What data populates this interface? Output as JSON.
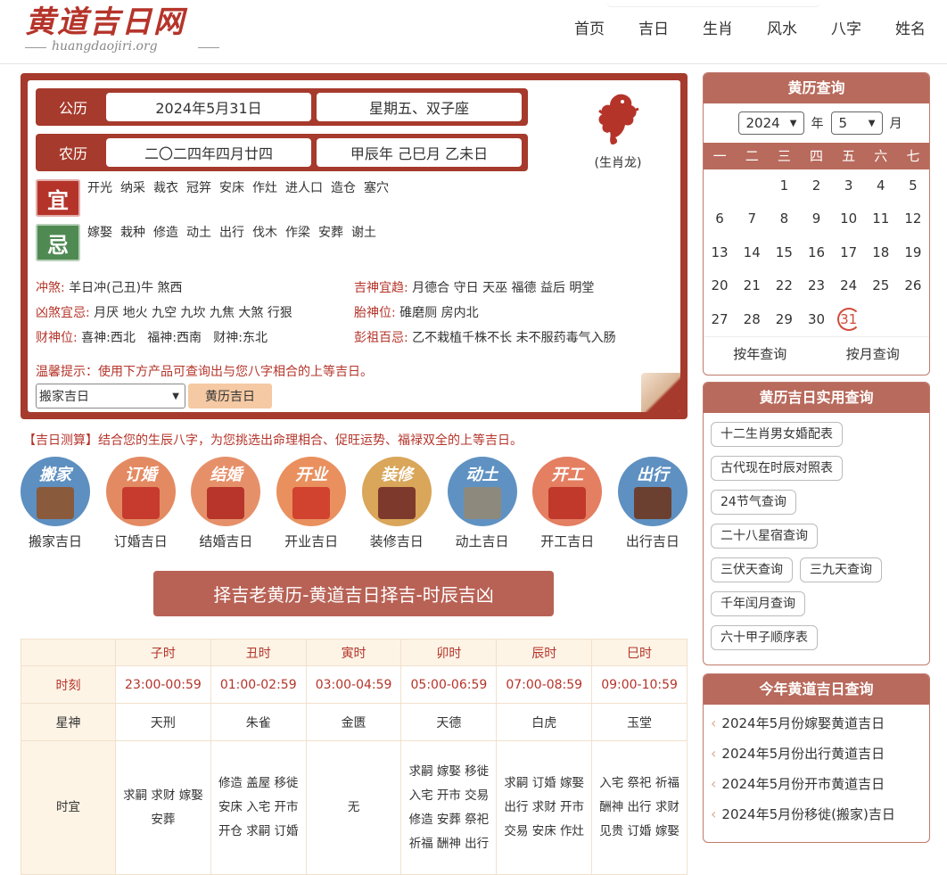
{
  "header": {
    "logo_title": "黄道吉日网",
    "logo_sub": "huangdaojiri.org",
    "nav": [
      "首页",
      "吉日",
      "生肖",
      "风水",
      "八字",
      "姓名"
    ]
  },
  "almanac": {
    "solar_label": "公历",
    "solar_date": "2024年5月31日",
    "weekday": "星期五、双子座",
    "lunar_label": "农历",
    "lunar_date": "二〇二四年四月廿四",
    "ganzhi": "甲辰年 己巳月 乙未日",
    "zodiac": "(生肖龙)",
    "yi_badge": "宜",
    "yi_items": [
      "开光",
      "纳采",
      "裁衣",
      "冠笄",
      "安床",
      "作灶",
      "进人口",
      "造仓",
      "塞穴"
    ],
    "ji_badge": "忌",
    "ji_items": [
      "嫁娶",
      "栽种",
      "修造",
      "动土",
      "出行",
      "伐木",
      "作梁",
      "安葬",
      "谢土"
    ],
    "chongsha_k": "冲煞:",
    "chongsha_v": "羊日冲(己丑)牛 煞西",
    "jishen_k": "吉神宜趋:",
    "jishen_v": "月德合 守日 天巫 福德 益后 明堂",
    "xiongsha_k": "凶煞宜忌:",
    "xiongsha_v": "月厌 地火 九空 九坎 九焦 大煞 行狠",
    "taishen_k": "胎神位:",
    "taishen_v": "碓磨厕 房内北",
    "caishen_k": "财神位:",
    "caishen_v": "喜神:西北   福神:西南   财神:东北",
    "pengzu_k": "彭祖百忌:",
    "pengzu_v": "乙不栽植千株不长 未不服药毒气入肠",
    "tip": "温馨提示：使用下方产品可查询出与您八字相合的上等吉日。",
    "select_value": "搬家吉日",
    "select_button": "黄历吉日"
  },
  "promo": {
    "text": "【吉日测算】结合您的生辰八字，为您挑选出命理相合、促旺运势、福禄双全的上等吉日。",
    "items": [
      {
        "title": "搬家",
        "label": "搬家吉日",
        "color": "#5d8fc0",
        "pic": "#8a5a3c"
      },
      {
        "title": "订婚",
        "label": "订婚吉日",
        "color": "#e48a62",
        "pic": "#c63b2e"
      },
      {
        "title": "结婚",
        "label": "结婚吉日",
        "color": "#e6906a",
        "pic": "#b7352a"
      },
      {
        "title": "开业",
        "label": "开业吉日",
        "color": "#e9905e",
        "pic": "#d1422f"
      },
      {
        "title": "装修",
        "label": "装修吉日",
        "color": "#d9a65a",
        "pic": "#7d3a2c"
      },
      {
        "title": "动土",
        "label": "动土吉日",
        "color": "#5f92c2",
        "pic": "#8d8a7d"
      },
      {
        "title": "开工",
        "label": "开工吉日",
        "color": "#e47f62",
        "pic": "#c0392b"
      },
      {
        "title": "出行",
        "label": "出行吉日",
        "color": "#5e90c1",
        "pic": "#6b4030"
      }
    ]
  },
  "banner": "择吉老黄历-黄道吉日择吉-时辰吉凶",
  "hours": {
    "names": [
      "子时",
      "丑时",
      "寅时",
      "卯时",
      "辰时",
      "巳时"
    ],
    "row_time_label": "时刻",
    "times": [
      "23:00-00:59",
      "01:00-02:59",
      "03:00-04:59",
      "05:00-06:59",
      "07:00-08:59",
      "09:00-10:59"
    ],
    "row_star_label": "星神",
    "stars": [
      "天刑",
      "朱雀",
      "金匮",
      "天德",
      "白虎",
      "玉堂"
    ],
    "row_yi_label": "时宜",
    "yi": [
      "求嗣 求财 嫁娶 安葬",
      "修造 盖屋 移徙 安床 入宅 开市 开仓 求嗣 订婚",
      "无",
      "求嗣 嫁娶 移徙 入宅 开市 交易 修造 安葬 祭祀 祈福 酬神 出行",
      "求嗣 订婚 嫁娶 出行 求财 开市 交易 安床 作灶",
      "入宅 祭祀 祈福 酬神 出行 求财 见贵 订婚 嫁娶"
    ]
  },
  "sidebar": {
    "cal_title": "黄历查询",
    "year": "2024",
    "year_unit": "年",
    "month": "5",
    "month_unit": "月",
    "weekdays": [
      "一",
      "二",
      "三",
      "四",
      "五",
      "六",
      "七"
    ],
    "days": [
      "",
      "",
      "1",
      "2",
      "3",
      "4",
      "5",
      "6",
      "7",
      "8",
      "9",
      "10",
      "11",
      "12",
      "13",
      "14",
      "15",
      "16",
      "17",
      "18",
      "19",
      "20",
      "21",
      "22",
      "23",
      "24",
      "25",
      "26",
      "27",
      "28",
      "29",
      "30",
      "31",
      "",
      ""
    ],
    "today": "31",
    "foot_year": "按年查询",
    "foot_month": "按月查询",
    "tools_title": "黄历吉日实用查询",
    "tools": [
      "十二生肖男女婚配表",
      "古代现在时辰对照表",
      "24节气查询",
      "二十八星宿查询",
      "三伏天查询",
      "三九天查询",
      "千年闰月查询",
      "六十甲子顺序表"
    ],
    "yearly_title": "今年黄道吉日查询",
    "yearly": [
      "2024年5月份嫁娶黄道吉日",
      "2024年5月份出行黄道吉日",
      "2024年5月份开市黄道吉日",
      "2024年5月份移徙(搬家)吉日"
    ]
  }
}
